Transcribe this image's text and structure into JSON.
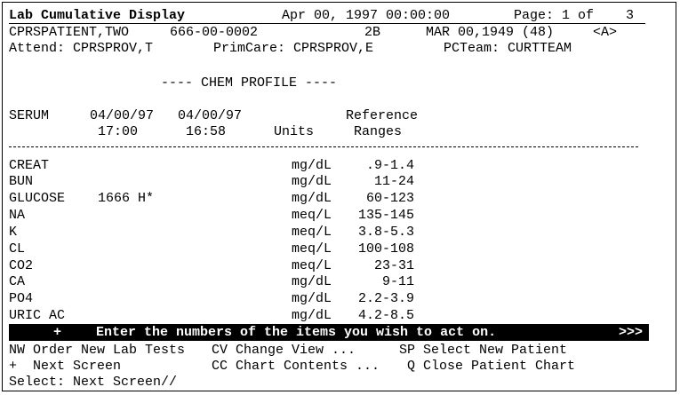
{
  "header": {
    "title": "Lab Cumulative Display",
    "datetime": "Apr 00, 1997 00:00:00",
    "page": "Page: 1 of    3"
  },
  "patient": {
    "name": "CPRSPATIENT,TWO",
    "ssn": "666-00-0002",
    "ward": "2B",
    "dob_age": "MAR 00,1949 (48)",
    "flag": "<A>",
    "attend": "Attend: CPRSPROV,T",
    "primcare": "PrimCare: CPRSPROV,E",
    "pcteam": "PCTeam: CURTTEAM"
  },
  "section_title": "---- CHEM PROFILE ----",
  "columns": {
    "specimen": "SERUM",
    "date1": "04/00/97",
    "date2": "04/00/97",
    "time1": "17:00",
    "time2": "16:58",
    "units": "Units",
    "reference_line1": "Reference",
    "reference_line2": "Ranges"
  },
  "rows": [
    {
      "test": "CREAT",
      "value": "",
      "units": "mg/dL",
      "range": ".9-1.4"
    },
    {
      "test": "BUN",
      "value": "",
      "units": "mg/dL",
      "range": "11-24"
    },
    {
      "test": "GLUCOSE",
      "value": "1666 H*",
      "units": "mg/dL",
      "range": "60-123"
    },
    {
      "test": "NA",
      "value": "",
      "units": "meq/L",
      "range": "135-145"
    },
    {
      "test": "K",
      "value": "",
      "units": "meq/L",
      "range": "3.8-5.3"
    },
    {
      "test": "CL",
      "value": "",
      "units": "meq/L",
      "range": "100-108"
    },
    {
      "test": "CO2",
      "value": "",
      "units": "meq/L",
      "range": "23-31"
    },
    {
      "test": "CA",
      "value": "",
      "units": "mg/dL",
      "range": "9-11"
    },
    {
      "test": "PO4",
      "value": "",
      "units": "mg/dL",
      "range": "2.2-3.9"
    },
    {
      "test": "URIC AC",
      "value": "",
      "units": "mg/dL",
      "range": "4.2-8.5"
    }
  ],
  "prompt_bar": {
    "plus": "+",
    "message": "Enter the numbers of the items you wish to act on.",
    "more": ">>>"
  },
  "actions": [
    {
      "label": "NW Order New Lab Tests"
    },
    {
      "label": "CV Change View ..."
    },
    {
      "label": "SP Select New Patient"
    },
    {
      "label": "+  Next Screen"
    },
    {
      "label": "CC Chart Contents ..."
    },
    {
      "label": "Q Close Patient Chart"
    }
  ],
  "select_prompt": "Select: Next Screen//"
}
